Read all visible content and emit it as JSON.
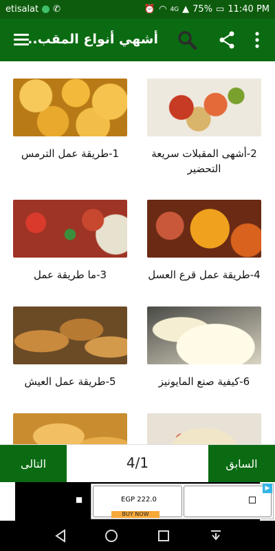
{
  "status_bar": {
    "carrier": "etisalat",
    "network_label": "4G",
    "battery": "75%",
    "time": "11:40 PM"
  },
  "app_bar": {
    "title": "أشهي أنواع المقب..",
    "icons": [
      "menu-icon",
      "search-icon",
      "share-icon",
      "more-vertical-icon"
    ]
  },
  "recipes": [
    {
      "caption": "1-طريقة عمل الترمس",
      "image": "lupini beans"
    },
    {
      "caption": "2-أشهى المقبلات سريعة التحضير",
      "image": "appetizer platter"
    },
    {
      "caption": "3-ما طريقة عمل",
      "image": "salad dish"
    },
    {
      "caption": "4-طريقة عمل قرع العسل",
      "image": "pumpkin soup"
    },
    {
      "caption": "5-طريقة عمل العيش",
      "image": "bread loaves"
    },
    {
      "caption": "6-كيفية صنع المايونيز",
      "image": "mayonnaise whisk"
    },
    {
      "caption": "",
      "image": "pastry"
    },
    {
      "caption": "",
      "image": "pasta"
    }
  ],
  "pager": {
    "prev_label": "السابق",
    "next_label": "التالى",
    "page_indicator": "4/1"
  },
  "ad": {
    "price": "EGP 222.0",
    "button": "BUY NOW"
  },
  "nav_bar": {
    "icons": [
      "back-icon",
      "home-icon",
      "recents-icon",
      "notification-pull-icon"
    ]
  }
}
